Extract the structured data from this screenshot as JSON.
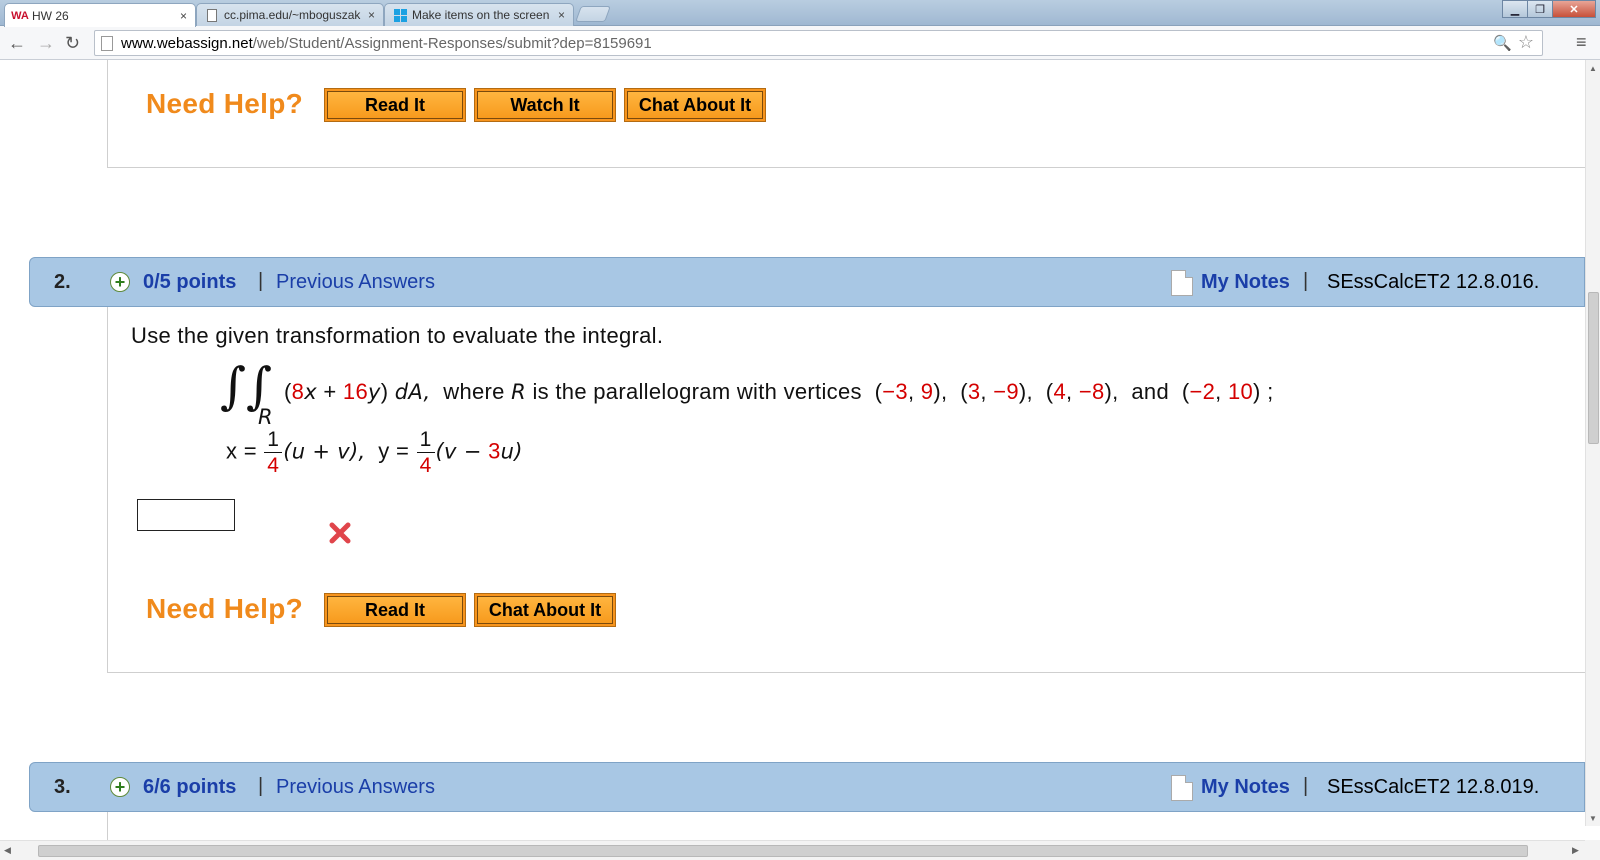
{
  "browser": {
    "tabs": [
      {
        "title": "HW 26",
        "favicon": "WA",
        "active": true
      },
      {
        "title": "cc.pima.edu/~mboguszak",
        "favicon": "page",
        "active": false
      },
      {
        "title": "Make items on the screen",
        "favicon": "windows",
        "active": false
      }
    ],
    "tab_close_glyph": "×",
    "window_buttons": {
      "minimize": "▁",
      "maximize": "❐",
      "close": "✕"
    },
    "url_host": "www.webassign.net",
    "url_path": "/web/Student/Assignment-Responses/submit?dep=8159691",
    "nav": {
      "back": "←",
      "forward": "→",
      "reload": "↻"
    },
    "zoom_icon": "🔍",
    "bookmark_star": "☆",
    "menu_icon": "≡"
  },
  "prev_question": {
    "need_help": "Need Help?",
    "buttons": [
      "Read It",
      "Watch It",
      "Chat About It"
    ]
  },
  "question2": {
    "number": "2.",
    "plus": "+",
    "points": "0/5 points",
    "separator": "|",
    "previous_answers": "Previous Answers",
    "my_notes": "My Notes",
    "source": "SEssCalcET2 12.8.016.",
    "prompt": "Use the given transformation to evaluate the integral.",
    "integral_sign": "∫∫",
    "region": "R",
    "integrand_open": "(",
    "coef1": "8",
    "var_x": "x",
    "plus_sign": "+",
    "coef2": "16",
    "var_y": "y",
    "integrand_close": ")",
    "dA": "dA,",
    "where_text": "where",
    "region_italic": "R",
    "parallelogram_text": "is the parallelogram with vertices",
    "vertices": [
      [
        "−3",
        "9"
      ],
      [
        "3",
        "−9"
      ],
      [
        "4",
        "−8"
      ],
      [
        "−2",
        "10"
      ]
    ],
    "and_text": "and",
    "semicolon": ";",
    "x_eq": "x =",
    "frac1_num": "1",
    "frac1_den": "4",
    "x_expr": "(u + v),",
    "y_eq": "y =",
    "frac2_num": "1",
    "frac2_den": "4",
    "y_expr_open": "(v −",
    "y_coef": "3",
    "y_expr_close": "u)",
    "answer_value": "",
    "need_help": "Need Help?",
    "buttons": [
      "Read It",
      "Chat About It"
    ]
  },
  "question3": {
    "number": "3.",
    "plus": "+",
    "points": "6/6 points",
    "separator": "|",
    "previous_answers": "Previous Answers",
    "my_notes": "My Notes",
    "source": "SEssCalcET2 12.8.019."
  },
  "colors": {
    "header_bg": "#a8c7e4",
    "link": "#1a3ea8",
    "help_orange": "#f08a1c",
    "value_red": "#d40000",
    "wrong_red": "#e0454b"
  }
}
